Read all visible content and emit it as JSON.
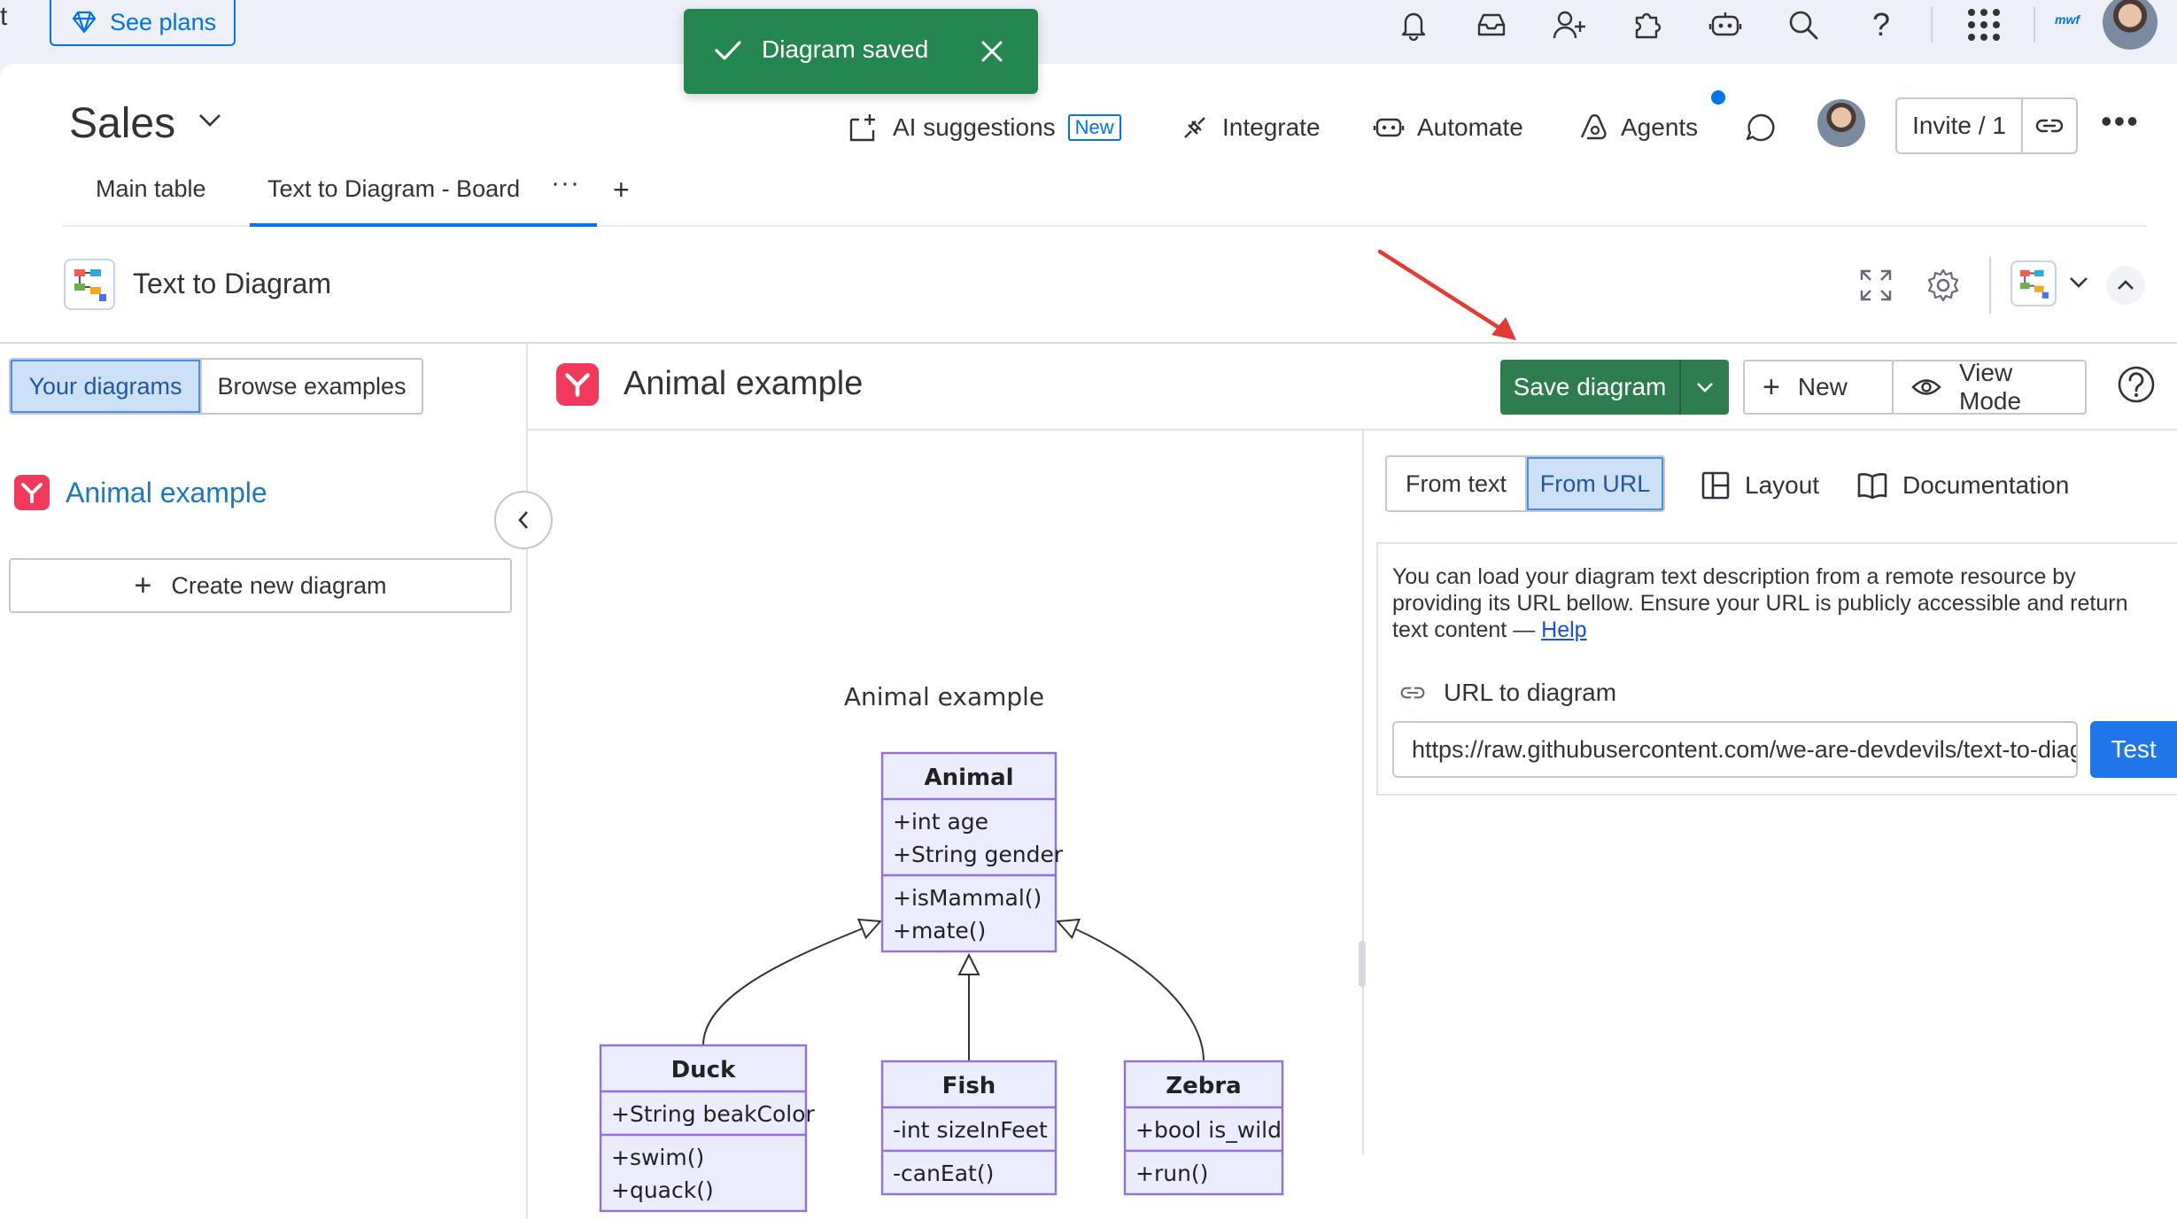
{
  "topbar": {
    "cut_text": "t",
    "see_plans": "See plans",
    "brand_tiny": "mwf",
    "help_glyph": "?"
  },
  "toast": {
    "message": "Diagram saved"
  },
  "board": {
    "title": "Sales",
    "actions": {
      "ai_suggestions": "AI suggestions",
      "ai_badge": "New",
      "integrate": "Integrate",
      "automate": "Automate",
      "agents": "Agents"
    },
    "invite": "Invite / 1",
    "tabs": [
      {
        "label": "Main table"
      },
      {
        "label": "Text to Diagram - Board"
      }
    ],
    "tab_more": "···",
    "tab_add": "+"
  },
  "widget": {
    "title": "Text to Diagram"
  },
  "app": {
    "sidebar": {
      "tabs": [
        "Your diagrams",
        "Browse examples"
      ],
      "items": [
        {
          "label": "Animal example"
        }
      ],
      "create_label": "Create new diagram"
    },
    "editor": {
      "title": "Animal example",
      "save_label": "Save diagram",
      "new_label": "New",
      "view_mode_label": "View Mode"
    },
    "right_panel": {
      "source_tabs": [
        "From text",
        "From URL"
      ],
      "layout_label": "Layout",
      "documentation_label": "Documentation",
      "description": "You can load your diagram text description from a remote resource by providing its URL bellow. Ensure your URL is publicly accessible and return text content — ",
      "help_link": "Help",
      "url_label": "URL to diagram",
      "url_value": "https://raw.githubusercontent.com/we-are-devdevils/text-to-diagram/animal-example.txt",
      "test_label": "Test"
    }
  },
  "diagram": {
    "title": "Animal example",
    "classes": [
      {
        "name": "Animal",
        "attributes": [
          "+int age",
          "+String gender"
        ],
        "methods": [
          "+isMammal()",
          "+mate()"
        ]
      },
      {
        "name": "Duck",
        "attributes": [
          "+String beakColor"
        ],
        "methods": [
          "+swim()",
          "+quack()"
        ]
      },
      {
        "name": "Fish",
        "attributes": [
          "-int sizeInFeet"
        ],
        "methods": [
          "-canEat()"
        ]
      },
      {
        "name": "Zebra",
        "attributes": [
          "+bool is_wild"
        ],
        "methods": [
          "+run()"
        ]
      }
    ]
  },
  "colors": {
    "accent": "#0073ea",
    "toast_green": "#258750",
    "save_green": "#2e7d4f",
    "uml_fill": "#ececff",
    "uml_stroke": "#9370db",
    "app_logo": "#f2385b",
    "annotation_arrow": "#e53935"
  }
}
